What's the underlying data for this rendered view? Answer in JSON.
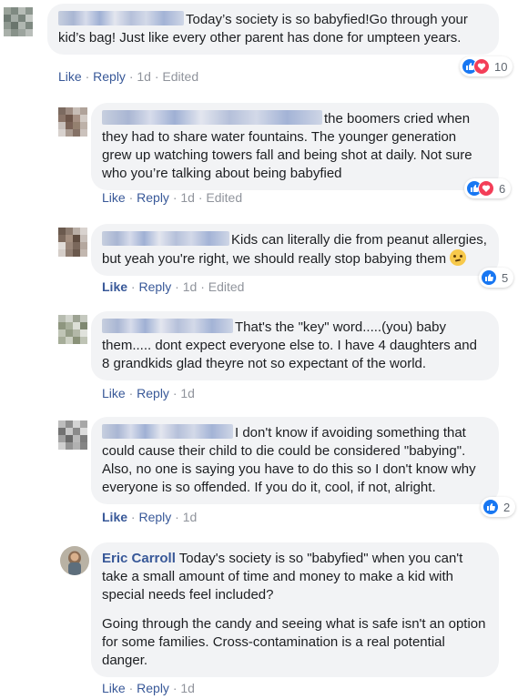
{
  "comments": [
    {
      "text": "Today’s society is so babyfied!Go through your kid’s bag! Just like every other parent has done for umpteen years.",
      "actions": {
        "like": "Like",
        "reply": "Reply",
        "time": "1d",
        "edited": "Edited"
      },
      "reactions": {
        "types": [
          "like-icon",
          "love-icon"
        ],
        "count": "10"
      }
    },
    {
      "text": "the boomers cried when they had to share water fountains. The younger generation grew up watching towers fall and being shot at daily. Not sure who you’re talking about being babyfied",
      "actions": {
        "like": "Like",
        "reply": "Reply",
        "time": "1d",
        "edited": "Edited"
      },
      "reactions": {
        "types": [
          "like-icon",
          "love-icon"
        ],
        "count": "6"
      }
    },
    {
      "text": "Kids can literally die from peanut allergies, but yeah you're right, we should really stop babying them",
      "emoji": "rolling-eyes-emoji",
      "actions": {
        "like": "Like",
        "reply": "Reply",
        "time": "1d",
        "edited": "Edited"
      },
      "reactions": {
        "types": [
          "like-icon"
        ],
        "count": "5"
      }
    },
    {
      "text": "That's the \"key\" word.....(you) baby them..... dont expect everyone else to. I have 4 daughters and 8 grandkids glad theyre not so expectant of the world.",
      "actions": {
        "like": "Like",
        "reply": "Reply",
        "time": "1d"
      }
    },
    {
      "text": "I don't know if avoiding something that could cause their child to die could be considered \"babying\". Also, no one is saying you have to do this so I don't know why everyone is so offended. If you do it, cool, if not, alright.",
      "actions": {
        "like": "Like",
        "reply": "Reply",
        "time": "1d"
      },
      "reactions": {
        "types": [
          "like-icon"
        ],
        "count": "2"
      }
    },
    {
      "name": "Eric Carroll",
      "text": "Today's society is so \"babyfied\" when you can't take a small amount of time and money to make a kid with special needs feel included?",
      "text2": "Going through the candy and seeing what is safe isn't an option for some families. Cross-contamination is a real potential danger.",
      "actions": {
        "like": "Like",
        "reply": "Reply",
        "time": "1d"
      }
    }
  ],
  "colors": {
    "link": "#385898",
    "bubble": "#f2f3f5",
    "like": "#1877f2",
    "love": "#f33e58",
    "meta": "#90949c"
  }
}
